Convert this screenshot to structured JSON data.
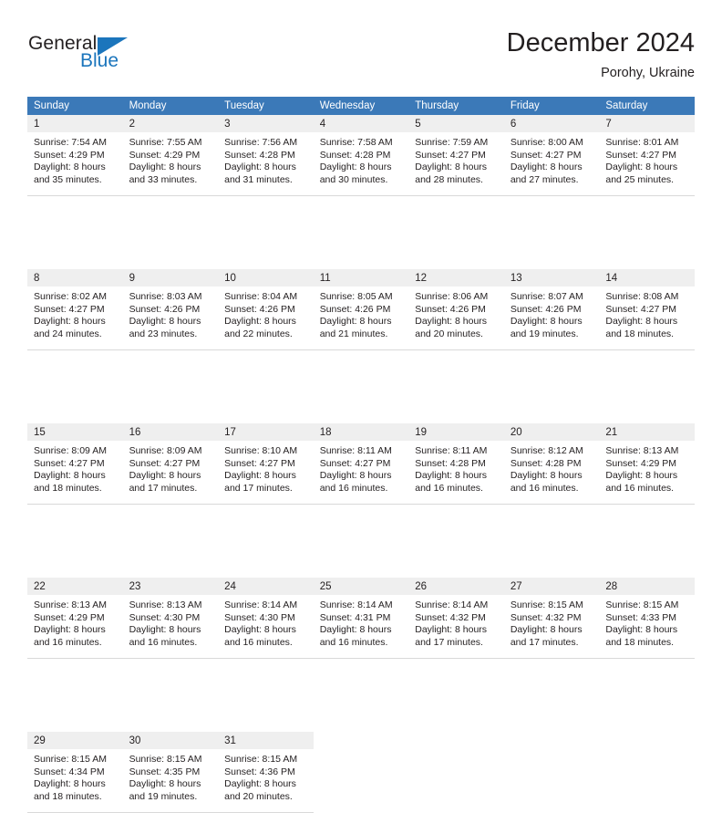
{
  "brand": {
    "name_part1": "General",
    "name_part2": "Blue"
  },
  "header": {
    "title": "December 2024",
    "subtitle": "Porohy, Ukraine"
  },
  "colors": {
    "header_blue": "#3b79b8",
    "brand_blue": "#1b75bc",
    "daynum_bg": "#efefef",
    "text": "#231f20"
  },
  "weekdays": [
    "Sunday",
    "Monday",
    "Tuesday",
    "Wednesday",
    "Thursday",
    "Friday",
    "Saturday"
  ],
  "weeks": [
    [
      {
        "day": "1",
        "sunrise": "Sunrise: 7:54 AM",
        "sunset": "Sunset: 4:29 PM",
        "daylight1": "Daylight: 8 hours",
        "daylight2": "and 35 minutes."
      },
      {
        "day": "2",
        "sunrise": "Sunrise: 7:55 AM",
        "sunset": "Sunset: 4:29 PM",
        "daylight1": "Daylight: 8 hours",
        "daylight2": "and 33 minutes."
      },
      {
        "day": "3",
        "sunrise": "Sunrise: 7:56 AM",
        "sunset": "Sunset: 4:28 PM",
        "daylight1": "Daylight: 8 hours",
        "daylight2": "and 31 minutes."
      },
      {
        "day": "4",
        "sunrise": "Sunrise: 7:58 AM",
        "sunset": "Sunset: 4:28 PM",
        "daylight1": "Daylight: 8 hours",
        "daylight2": "and 30 minutes."
      },
      {
        "day": "5",
        "sunrise": "Sunrise: 7:59 AM",
        "sunset": "Sunset: 4:27 PM",
        "daylight1": "Daylight: 8 hours",
        "daylight2": "and 28 minutes."
      },
      {
        "day": "6",
        "sunrise": "Sunrise: 8:00 AM",
        "sunset": "Sunset: 4:27 PM",
        "daylight1": "Daylight: 8 hours",
        "daylight2": "and 27 minutes."
      },
      {
        "day": "7",
        "sunrise": "Sunrise: 8:01 AM",
        "sunset": "Sunset: 4:27 PM",
        "daylight1": "Daylight: 8 hours",
        "daylight2": "and 25 minutes."
      }
    ],
    [
      {
        "day": "8",
        "sunrise": "Sunrise: 8:02 AM",
        "sunset": "Sunset: 4:27 PM",
        "daylight1": "Daylight: 8 hours",
        "daylight2": "and 24 minutes."
      },
      {
        "day": "9",
        "sunrise": "Sunrise: 8:03 AM",
        "sunset": "Sunset: 4:26 PM",
        "daylight1": "Daylight: 8 hours",
        "daylight2": "and 23 minutes."
      },
      {
        "day": "10",
        "sunrise": "Sunrise: 8:04 AM",
        "sunset": "Sunset: 4:26 PM",
        "daylight1": "Daylight: 8 hours",
        "daylight2": "and 22 minutes."
      },
      {
        "day": "11",
        "sunrise": "Sunrise: 8:05 AM",
        "sunset": "Sunset: 4:26 PM",
        "daylight1": "Daylight: 8 hours",
        "daylight2": "and 21 minutes."
      },
      {
        "day": "12",
        "sunrise": "Sunrise: 8:06 AM",
        "sunset": "Sunset: 4:26 PM",
        "daylight1": "Daylight: 8 hours",
        "daylight2": "and 20 minutes."
      },
      {
        "day": "13",
        "sunrise": "Sunrise: 8:07 AM",
        "sunset": "Sunset: 4:26 PM",
        "daylight1": "Daylight: 8 hours",
        "daylight2": "and 19 minutes."
      },
      {
        "day": "14",
        "sunrise": "Sunrise: 8:08 AM",
        "sunset": "Sunset: 4:27 PM",
        "daylight1": "Daylight: 8 hours",
        "daylight2": "and 18 minutes."
      }
    ],
    [
      {
        "day": "15",
        "sunrise": "Sunrise: 8:09 AM",
        "sunset": "Sunset: 4:27 PM",
        "daylight1": "Daylight: 8 hours",
        "daylight2": "and 18 minutes."
      },
      {
        "day": "16",
        "sunrise": "Sunrise: 8:09 AM",
        "sunset": "Sunset: 4:27 PM",
        "daylight1": "Daylight: 8 hours",
        "daylight2": "and 17 minutes."
      },
      {
        "day": "17",
        "sunrise": "Sunrise: 8:10 AM",
        "sunset": "Sunset: 4:27 PM",
        "daylight1": "Daylight: 8 hours",
        "daylight2": "and 17 minutes."
      },
      {
        "day": "18",
        "sunrise": "Sunrise: 8:11 AM",
        "sunset": "Sunset: 4:27 PM",
        "daylight1": "Daylight: 8 hours",
        "daylight2": "and 16 minutes."
      },
      {
        "day": "19",
        "sunrise": "Sunrise: 8:11 AM",
        "sunset": "Sunset: 4:28 PM",
        "daylight1": "Daylight: 8 hours",
        "daylight2": "and 16 minutes."
      },
      {
        "day": "20",
        "sunrise": "Sunrise: 8:12 AM",
        "sunset": "Sunset: 4:28 PM",
        "daylight1": "Daylight: 8 hours",
        "daylight2": "and 16 minutes."
      },
      {
        "day": "21",
        "sunrise": "Sunrise: 8:13 AM",
        "sunset": "Sunset: 4:29 PM",
        "daylight1": "Daylight: 8 hours",
        "daylight2": "and 16 minutes."
      }
    ],
    [
      {
        "day": "22",
        "sunrise": "Sunrise: 8:13 AM",
        "sunset": "Sunset: 4:29 PM",
        "daylight1": "Daylight: 8 hours",
        "daylight2": "and 16 minutes."
      },
      {
        "day": "23",
        "sunrise": "Sunrise: 8:13 AM",
        "sunset": "Sunset: 4:30 PM",
        "daylight1": "Daylight: 8 hours",
        "daylight2": "and 16 minutes."
      },
      {
        "day": "24",
        "sunrise": "Sunrise: 8:14 AM",
        "sunset": "Sunset: 4:30 PM",
        "daylight1": "Daylight: 8 hours",
        "daylight2": "and 16 minutes."
      },
      {
        "day": "25",
        "sunrise": "Sunrise: 8:14 AM",
        "sunset": "Sunset: 4:31 PM",
        "daylight1": "Daylight: 8 hours",
        "daylight2": "and 16 minutes."
      },
      {
        "day": "26",
        "sunrise": "Sunrise: 8:14 AM",
        "sunset": "Sunset: 4:32 PM",
        "daylight1": "Daylight: 8 hours",
        "daylight2": "and 17 minutes."
      },
      {
        "day": "27",
        "sunrise": "Sunrise: 8:15 AM",
        "sunset": "Sunset: 4:32 PM",
        "daylight1": "Daylight: 8 hours",
        "daylight2": "and 17 minutes."
      },
      {
        "day": "28",
        "sunrise": "Sunrise: 8:15 AM",
        "sunset": "Sunset: 4:33 PM",
        "daylight1": "Daylight: 8 hours",
        "daylight2": "and 18 minutes."
      }
    ],
    [
      {
        "day": "29",
        "sunrise": "Sunrise: 8:15 AM",
        "sunset": "Sunset: 4:34 PM",
        "daylight1": "Daylight: 8 hours",
        "daylight2": "and 18 minutes."
      },
      {
        "day": "30",
        "sunrise": "Sunrise: 8:15 AM",
        "sunset": "Sunset: 4:35 PM",
        "daylight1": "Daylight: 8 hours",
        "daylight2": "and 19 minutes."
      },
      {
        "day": "31",
        "sunrise": "Sunrise: 8:15 AM",
        "sunset": "Sunset: 4:36 PM",
        "daylight1": "Daylight: 8 hours",
        "daylight2": "and 20 minutes."
      },
      {
        "day": "",
        "sunrise": "",
        "sunset": "",
        "daylight1": "",
        "daylight2": ""
      },
      {
        "day": "",
        "sunrise": "",
        "sunset": "",
        "daylight1": "",
        "daylight2": ""
      },
      {
        "day": "",
        "sunrise": "",
        "sunset": "",
        "daylight1": "",
        "daylight2": ""
      },
      {
        "day": "",
        "sunrise": "",
        "sunset": "",
        "daylight1": "",
        "daylight2": ""
      }
    ]
  ]
}
